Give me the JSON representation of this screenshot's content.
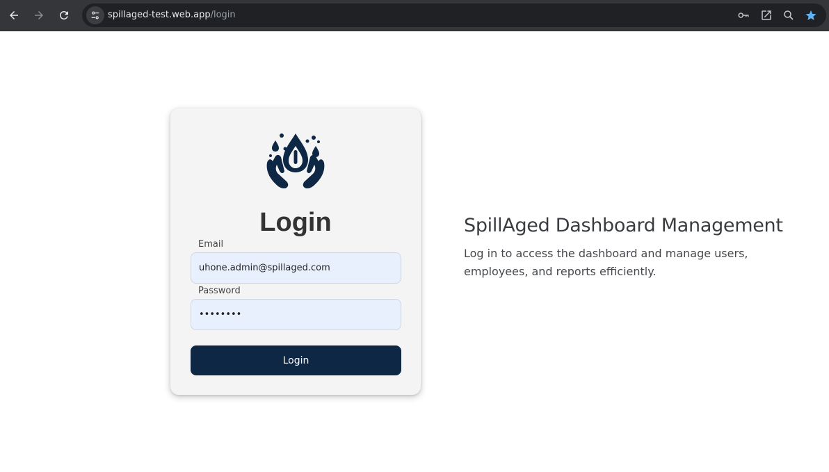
{
  "browser": {
    "url_host": "spillaged-test.web.app",
    "url_path": "/login",
    "icons": {
      "back": "arrow-left-icon",
      "forward": "arrow-right-icon",
      "reload": "reload-icon",
      "site_info": "tune-icon",
      "password": "key-icon",
      "open_in_app": "external-link-icon",
      "zoom": "zoom-icon",
      "bookmark": "star-icon"
    },
    "colors": {
      "bookmark_star": "#5fb3f5"
    }
  },
  "login_card": {
    "title": "Login",
    "logo_icon": "water-drop-hands-icon",
    "email": {
      "label": "Email",
      "value": "uhone.admin@spillaged.com"
    },
    "password": {
      "label": "Password",
      "value": "••••••••"
    },
    "submit_label": "Login",
    "colors": {
      "button": "#0d2744",
      "input_bg": "#e8f0fe"
    }
  },
  "intro": {
    "heading": "SpillAged Dashboard Management",
    "description": "Log in to access the dashboard and manage users, employees, and reports efficiently."
  }
}
